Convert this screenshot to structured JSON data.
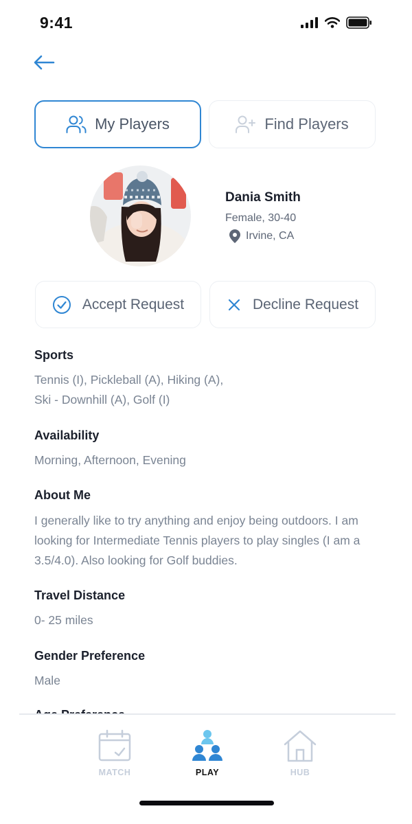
{
  "status": {
    "time": "9:41"
  },
  "segments": {
    "my_players": "My Players",
    "find_players": "Find Players"
  },
  "profile": {
    "name": "Dania Smith",
    "gender_age": "Female, 30-40",
    "location": "Irvine, CA"
  },
  "actions": {
    "accept": "Accept Request",
    "decline": "Decline Request"
  },
  "details": {
    "sports_title": "Sports",
    "sports_line1": "Tennis (I), Pickleball (A), Hiking (A),",
    "sports_line2": "Ski - Downhill (A), Golf (I)",
    "availability_title": "Availability",
    "availability_value": "Morning, Afternoon, Evening",
    "about_title": "About Me",
    "about_value": "I generally like to try anything and enjoy being outdoors. I am looking for Intermediate Tennis players to play singles (I am a 3.5/4.0). Also looking for Golf buddies.",
    "travel_title": "Travel Distance",
    "travel_value": "0- 25 miles",
    "gender_pref_title": "Gender Preference",
    "gender_pref_value": "Male",
    "age_pref_title": "Age Preference"
  },
  "tabs": [
    {
      "label": "MATCH",
      "icon": "calendar-check-icon",
      "active": false
    },
    {
      "label": "PLAY",
      "icon": "players-group-icon",
      "active": true
    },
    {
      "label": "HUB",
      "icon": "home-icon",
      "active": false
    }
  ],
  "colors": {
    "accent": "#2f86d3",
    "text_primary": "#1c2230",
    "text_secondary": "#7a8493",
    "tab_inactive": "#c5cedb",
    "tab_active_light": "#6cc6ee"
  }
}
